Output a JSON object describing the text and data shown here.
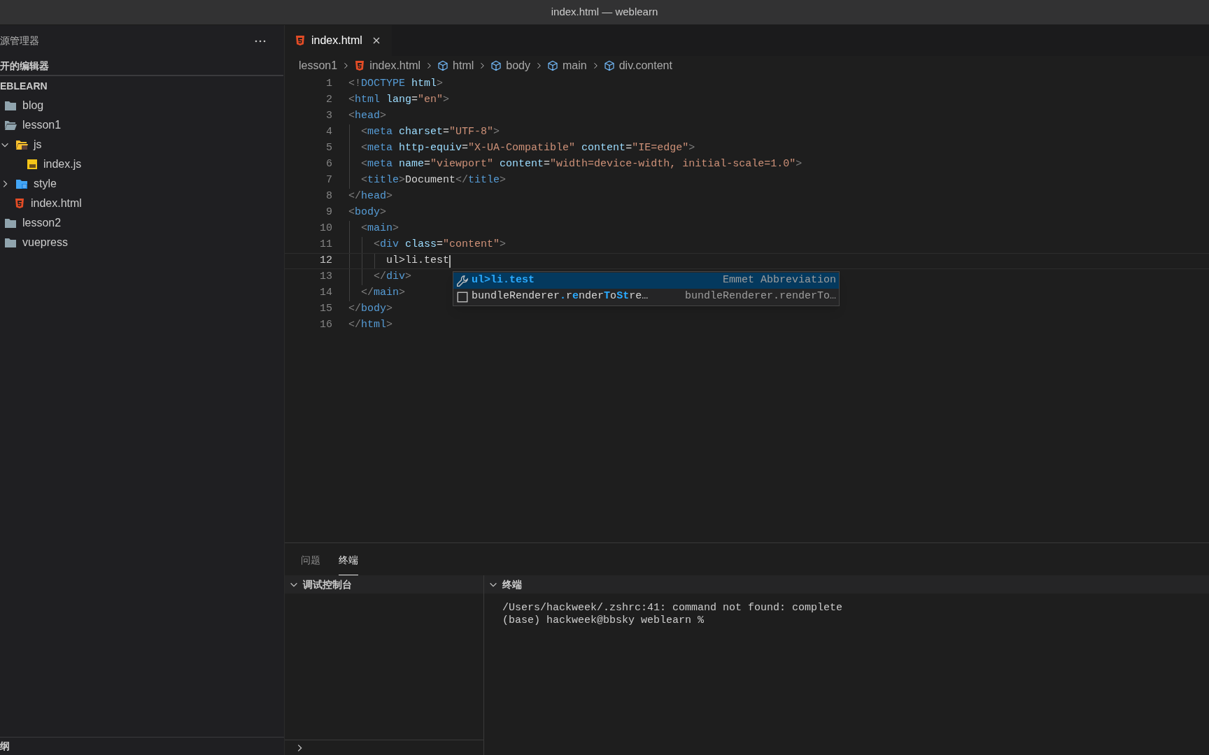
{
  "window": {
    "title": "index.html — weblearn"
  },
  "sidebar": {
    "title": "源管理器",
    "open_editors": {
      "title": "开的编辑器"
    },
    "explorer": {
      "title": "EBLEARN",
      "tree": [
        {
          "label": "blog",
          "kind": "folder",
          "expanded": false
        },
        {
          "label": "lesson1",
          "kind": "folder",
          "expanded": true,
          "children": [
            {
              "label": "js",
              "kind": "js-folder",
              "expanded": true,
              "children": [
                {
                  "label": "index.js",
                  "kind": "js"
                }
              ]
            },
            {
              "label": "style",
              "kind": "style-folder",
              "expanded": false
            },
            {
              "label": "index.html",
              "kind": "html"
            }
          ]
        },
        {
          "label": "lesson2",
          "kind": "folder",
          "expanded": false
        },
        {
          "label": "vuepress",
          "kind": "folder",
          "expanded": false
        }
      ]
    },
    "outline": {
      "title": "纲"
    }
  },
  "tabs": [
    {
      "label": "index.html",
      "selected": true
    }
  ],
  "breadcrumbs": [
    {
      "label": "lesson1"
    },
    {
      "label": "index.html"
    },
    {
      "label": "html"
    },
    {
      "label": "body"
    },
    {
      "label": "main"
    },
    {
      "label": "div.content"
    }
  ],
  "code": [
    {
      "number": "1",
      "selected": false,
      "tokens": [
        {
          "kind": "punct",
          "text": "<!"
        },
        {
          "kind": "tag",
          "text": "DOCTYPE"
        },
        {
          "kind": "attr",
          "text": " html"
        },
        {
          "kind": "punct",
          "text": ">"
        }
      ]
    },
    {
      "number": "2",
      "selected": false,
      "tokens": [
        {
          "kind": "punct",
          "text": "<"
        },
        {
          "kind": "tag",
          "text": "html"
        },
        {
          "kind": "attr",
          "text": " lang"
        },
        {
          "kind": "text",
          "text": "="
        },
        {
          "kind": "string",
          "text": "\"en\""
        },
        {
          "kind": "punct",
          "text": ">"
        }
      ]
    },
    {
      "number": "3",
      "selected": false,
      "tokens": [
        {
          "kind": "punct",
          "text": "<"
        },
        {
          "kind": "tag",
          "text": "head"
        },
        {
          "kind": "punct",
          "text": ">"
        }
      ]
    },
    {
      "number": "4",
      "selected": false,
      "tokens": [
        {
          "kind": "punct",
          "text": "  <"
        },
        {
          "kind": "tag",
          "text": "meta"
        },
        {
          "kind": "attr",
          "text": " charset"
        },
        {
          "kind": "text",
          "text": "="
        },
        {
          "kind": "string",
          "text": "\"UTF-8\""
        },
        {
          "kind": "punct",
          "text": ">"
        }
      ]
    },
    {
      "number": "5",
      "selected": false,
      "tokens": [
        {
          "kind": "punct",
          "text": "  <"
        },
        {
          "kind": "tag",
          "text": "meta"
        },
        {
          "kind": "attr",
          "text": " http-equiv"
        },
        {
          "kind": "text",
          "text": "="
        },
        {
          "kind": "string",
          "text": "\"X-UA-Compatible\""
        },
        {
          "kind": "attr",
          "text": " content"
        },
        {
          "kind": "text",
          "text": "="
        },
        {
          "kind": "string",
          "text": "\"IE=edge\""
        },
        {
          "kind": "punct",
          "text": ">"
        }
      ]
    },
    {
      "number": "6",
      "selected": false,
      "tokens": [
        {
          "kind": "punct",
          "text": "  <"
        },
        {
          "kind": "tag",
          "text": "meta"
        },
        {
          "kind": "attr",
          "text": " name"
        },
        {
          "kind": "text",
          "text": "="
        },
        {
          "kind": "string",
          "text": "\"viewport\""
        },
        {
          "kind": "attr",
          "text": " content"
        },
        {
          "kind": "text",
          "text": "="
        },
        {
          "kind": "string",
          "text": "\"width=device-width, initial-scale=1.0\""
        },
        {
          "kind": "punct",
          "text": ">"
        }
      ]
    },
    {
      "number": "7",
      "selected": false,
      "tokens": [
        {
          "kind": "punct",
          "text": "  <"
        },
        {
          "kind": "tag",
          "text": "title"
        },
        {
          "kind": "punct",
          "text": ">"
        },
        {
          "kind": "text",
          "text": "Document"
        },
        {
          "kind": "punct",
          "text": "</"
        },
        {
          "kind": "tag",
          "text": "title"
        },
        {
          "kind": "punct",
          "text": ">"
        }
      ]
    },
    {
      "number": "8",
      "selected": false,
      "tokens": [
        {
          "kind": "punct",
          "text": "</"
        },
        {
          "kind": "tag",
          "text": "head"
        },
        {
          "kind": "punct",
          "text": ">"
        }
      ]
    },
    {
      "number": "9",
      "selected": false,
      "tokens": [
        {
          "kind": "punct",
          "text": "<"
        },
        {
          "kind": "tag",
          "text": "body"
        },
        {
          "kind": "punct",
          "text": ">"
        }
      ]
    },
    {
      "number": "10",
      "selected": false,
      "tokens": [
        {
          "kind": "punct",
          "text": "  <"
        },
        {
          "kind": "tag",
          "text": "main"
        },
        {
          "kind": "punct",
          "text": ">"
        }
      ]
    },
    {
      "number": "11",
      "selected": false,
      "tokens": [
        {
          "kind": "punct",
          "text": "    <"
        },
        {
          "kind": "tag",
          "text": "div"
        },
        {
          "kind": "attr",
          "text": " class"
        },
        {
          "kind": "text",
          "text": "="
        },
        {
          "kind": "string",
          "text": "\"content\""
        },
        {
          "kind": "punct",
          "text": ">"
        }
      ]
    },
    {
      "number": "12",
      "selected": true,
      "tokens": [
        {
          "kind": "text",
          "text": "      ul>li.test"
        }
      ]
    },
    {
      "number": "13",
      "selected": false,
      "tokens": [
        {
          "kind": "punct",
          "text": "    </"
        },
        {
          "kind": "tag",
          "text": "div"
        },
        {
          "kind": "punct",
          "text": ">"
        }
      ]
    },
    {
      "number": "14",
      "selected": false,
      "tokens": [
        {
          "kind": "punct",
          "text": "  </"
        },
        {
          "kind": "tag",
          "text": "main"
        },
        {
          "kind": "punct",
          "text": ">"
        }
      ]
    },
    {
      "number": "15",
      "selected": false,
      "tokens": [
        {
          "kind": "punct",
          "text": "</"
        },
        {
          "kind": "tag",
          "text": "body"
        },
        {
          "kind": "punct",
          "text": ">"
        }
      ]
    },
    {
      "number": "16",
      "selected": false,
      "tokens": [
        {
          "kind": "punct",
          "text": "</"
        },
        {
          "kind": "tag",
          "text": "html"
        },
        {
          "kind": "punct",
          "text": ">"
        }
      ]
    }
  ],
  "suggest": {
    "items": [
      {
        "kind": "snippet",
        "selected": true,
        "label": [
          {
            "text": "ul>li.test",
            "match": true
          }
        ],
        "detail": "Emmet Abbreviation"
      },
      {
        "kind": "symbol",
        "selected": false,
        "label": [
          {
            "text": "bundleRenderer",
            "match": false
          },
          {
            "text": ".",
            "match": true
          },
          {
            "text": "r",
            "match": false
          },
          {
            "text": "e",
            "match": true
          },
          {
            "text": "nder",
            "match": false
          },
          {
            "text": "T",
            "match": true
          },
          {
            "text": "o",
            "match": false
          },
          {
            "text": "St",
            "match": true
          },
          {
            "text": "re…",
            "match": false
          }
        ],
        "detail": "bundleRenderer.renderTo…"
      }
    ]
  },
  "panel": {
    "tabs": [
      {
        "label": "问题",
        "selected": false
      },
      {
        "label": "终端",
        "selected": true
      }
    ],
    "panes": [
      {
        "title": "调试控制台",
        "expanded": true
      },
      {
        "title": "终端",
        "expanded": true,
        "lines": [
          "/Users/hackweek/.zshrc:41: command not found: complete",
          "(base) hackweek@bbsky weblearn %"
        ]
      }
    ]
  }
}
